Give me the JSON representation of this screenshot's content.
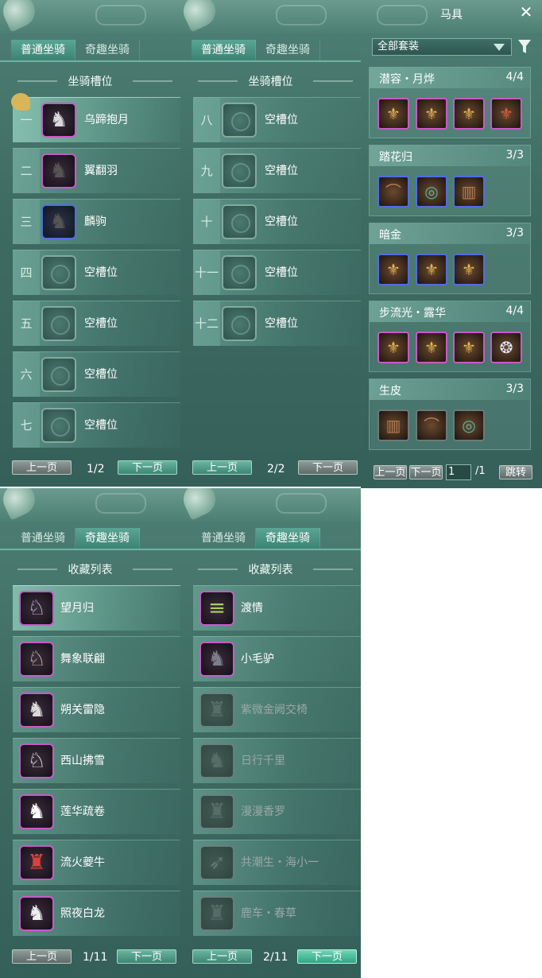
{
  "tabs": {
    "normal": "普通坐骑",
    "fun": "奇趣坐骑"
  },
  "slot_title": "坐骑槽位",
  "collection_title": "收藏列表",
  "buttons": {
    "prev": "上一页",
    "next": "下一页",
    "jump": "跳转"
  },
  "panel1": {
    "page": "1/2",
    "rows": [
      {
        "num": "一",
        "label": "乌蹄抱月",
        "icon": "white-horse-icon"
      },
      {
        "num": "二",
        "label": "翼翻羽",
        "icon": "black-horse-icon"
      },
      {
        "num": "三",
        "label": "麟驹",
        "icon": "black-horse-icon"
      },
      {
        "num": "四",
        "label": "空槽位",
        "icon": "empty-slot-icon"
      },
      {
        "num": "五",
        "label": "空槽位",
        "icon": "empty-slot-icon"
      },
      {
        "num": "六",
        "label": "空槽位",
        "icon": "empty-slot-icon"
      },
      {
        "num": "七",
        "label": "空槽位",
        "icon": "empty-slot-icon"
      }
    ]
  },
  "panel2": {
    "page": "2/2",
    "rows": [
      {
        "num": "八",
        "label": "空槽位"
      },
      {
        "num": "九",
        "label": "空槽位"
      },
      {
        "num": "十",
        "label": "空槽位"
      },
      {
        "num": "十一",
        "label": "空槽位"
      },
      {
        "num": "十二",
        "label": "空槽位"
      }
    ]
  },
  "gear": {
    "title": "马具",
    "dropdown": "全部套装",
    "page_input": "1",
    "page_total": "/1",
    "sets": [
      {
        "name": "潜容・月烨",
        "count": "4/4"
      },
      {
        "name": "踏花归",
        "count": "3/3"
      },
      {
        "name": "暗金",
        "count": "3/3"
      },
      {
        "name": "步流光・露华",
        "count": "4/4"
      },
      {
        "name": "生皮",
        "count": "3/3"
      }
    ]
  },
  "panel3": {
    "page": "1/11",
    "rows": [
      {
        "label": "望月归",
        "icon": "moon-deer-icon"
      },
      {
        "label": "舞象联翩",
        "icon": "elephant-icon"
      },
      {
        "label": "朔关雷隐",
        "icon": "grey-horse-icon"
      },
      {
        "label": "西山拂雪",
        "icon": "white-deer-icon"
      },
      {
        "label": "莲华疏卷",
        "icon": "white-horse-icon"
      },
      {
        "label": "流火夔牛",
        "icon": "fire-ox-icon"
      },
      {
        "label": "照夜白龙",
        "icon": "white-dragon-icon"
      }
    ]
  },
  "panel4": {
    "page": "2/11",
    "rows": [
      {
        "label": "渡情",
        "icon": "bamboo-raft-icon",
        "owned": true
      },
      {
        "label": "小毛驴",
        "icon": "donkey-icon",
        "owned": true
      },
      {
        "label": "紫微金阙交椅",
        "icon": "chair-icon",
        "owned": false
      },
      {
        "label": "日行千里",
        "icon": "bear-icon",
        "owned": false
      },
      {
        "label": "漫漫香罗",
        "icon": "cart-icon",
        "owned": false
      },
      {
        "label": "共潮生・海小一",
        "icon": "fish-icon",
        "owned": false
      },
      {
        "label": "鹿车・春草",
        "icon": "deer-cart-icon",
        "owned": false
      }
    ]
  }
}
